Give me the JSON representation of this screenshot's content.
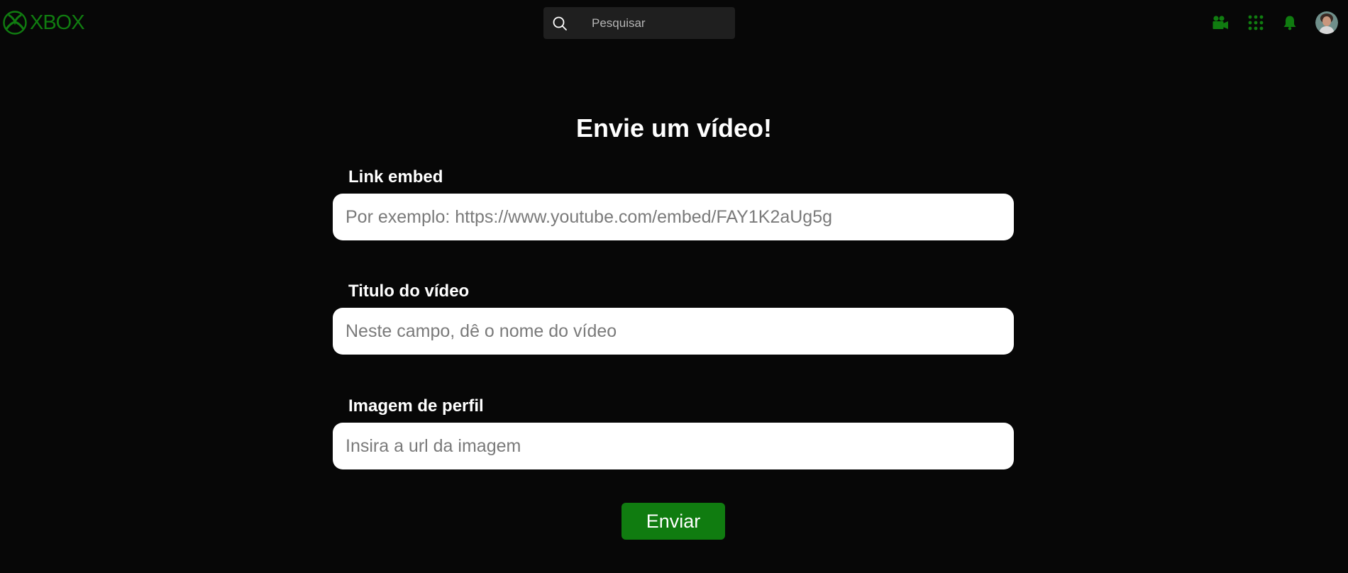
{
  "header": {
    "logo_text": "XBOX",
    "search": {
      "placeholder": "Pesquisar"
    },
    "actions": [
      {
        "icon": "video-camera-icon"
      },
      {
        "icon": "apps-grid-icon"
      },
      {
        "icon": "bell-icon"
      },
      {
        "icon": "user-avatar"
      }
    ]
  },
  "form": {
    "title": "Envie um vídeo!",
    "fields": [
      {
        "label": "Link embed",
        "value": "",
        "placeholder": "Por exemplo: https://www.youtube.com/embed/FAY1K2aUg5g"
      },
      {
        "label": "Titulo do vídeo",
        "value": "",
        "placeholder": "Neste campo, dê o nome do vídeo"
      },
      {
        "label": "Imagem de perfil",
        "value": "",
        "placeholder": "Insira a url da imagem"
      }
    ],
    "submit_label": "Enviar"
  },
  "colors": {
    "accent": "#107c10",
    "background": "#070707",
    "search_bg": "#1f1f1f",
    "input_bg": "#ffffff"
  }
}
